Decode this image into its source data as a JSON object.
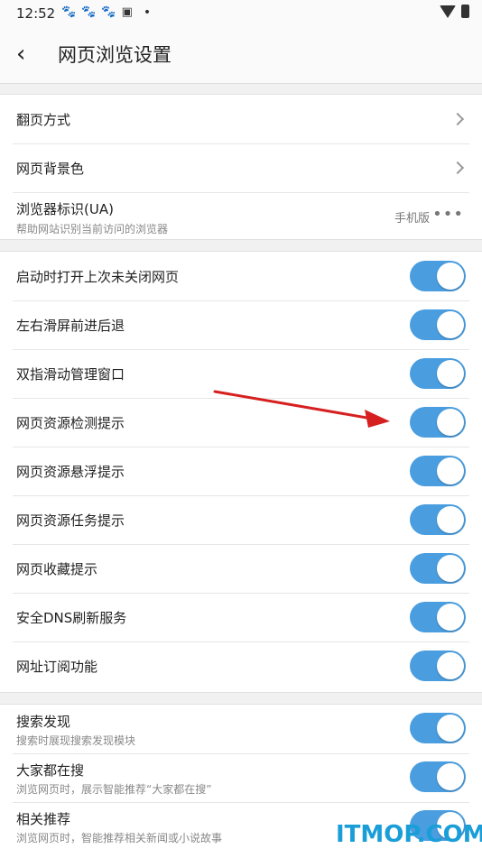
{
  "status_bar": {
    "time": "12:52",
    "notification_icons": [
      "paw-icon",
      "paw-icon",
      "paw-icon",
      "image-icon"
    ],
    "dot": "•"
  },
  "header": {
    "back_icon": "back-icon",
    "title": "网页浏览设置"
  },
  "group1": {
    "items": [
      {
        "label": "翻页方式",
        "icon": "chevron-right-icon"
      },
      {
        "label": "网页背景色",
        "icon": "chevron-right-icon"
      },
      {
        "label": "浏览器标识(UA)",
        "sub": "帮助网站识别当前访问的浏览器",
        "value": "手机版",
        "more": "•••"
      }
    ]
  },
  "group2": {
    "items": [
      {
        "label": "启动时打开上次未关闭网页",
        "on": true
      },
      {
        "label": "左右滑屏前进后退",
        "on": true
      },
      {
        "label": "双指滑动管理窗口",
        "on": true
      },
      {
        "label": "网页资源检测提示",
        "on": true
      },
      {
        "label": "网页资源悬浮提示",
        "on": true
      },
      {
        "label": "网页资源任务提示",
        "on": true
      },
      {
        "label": "网页收藏提示",
        "on": true
      },
      {
        "label": "安全DNS刷新服务",
        "on": true
      },
      {
        "label": "网址订阅功能",
        "on": true
      }
    ]
  },
  "group3": {
    "items": [
      {
        "label": "搜索发现",
        "sub": "搜索时展现搜索发现模块",
        "on": true
      },
      {
        "label": "大家都在搜",
        "sub": "浏览网页时，展示智能推荐“大家都在搜”",
        "on": true
      },
      {
        "label": "相关推荐",
        "sub": "浏览网页时，智能推荐相关新闻或小说故事",
        "on": true
      }
    ]
  },
  "colors": {
    "toggle_on": "#4a9ee0",
    "annotation_arrow": "#d62020",
    "watermark": "#1a9ed8"
  },
  "watermark": "ITMOP.COM"
}
